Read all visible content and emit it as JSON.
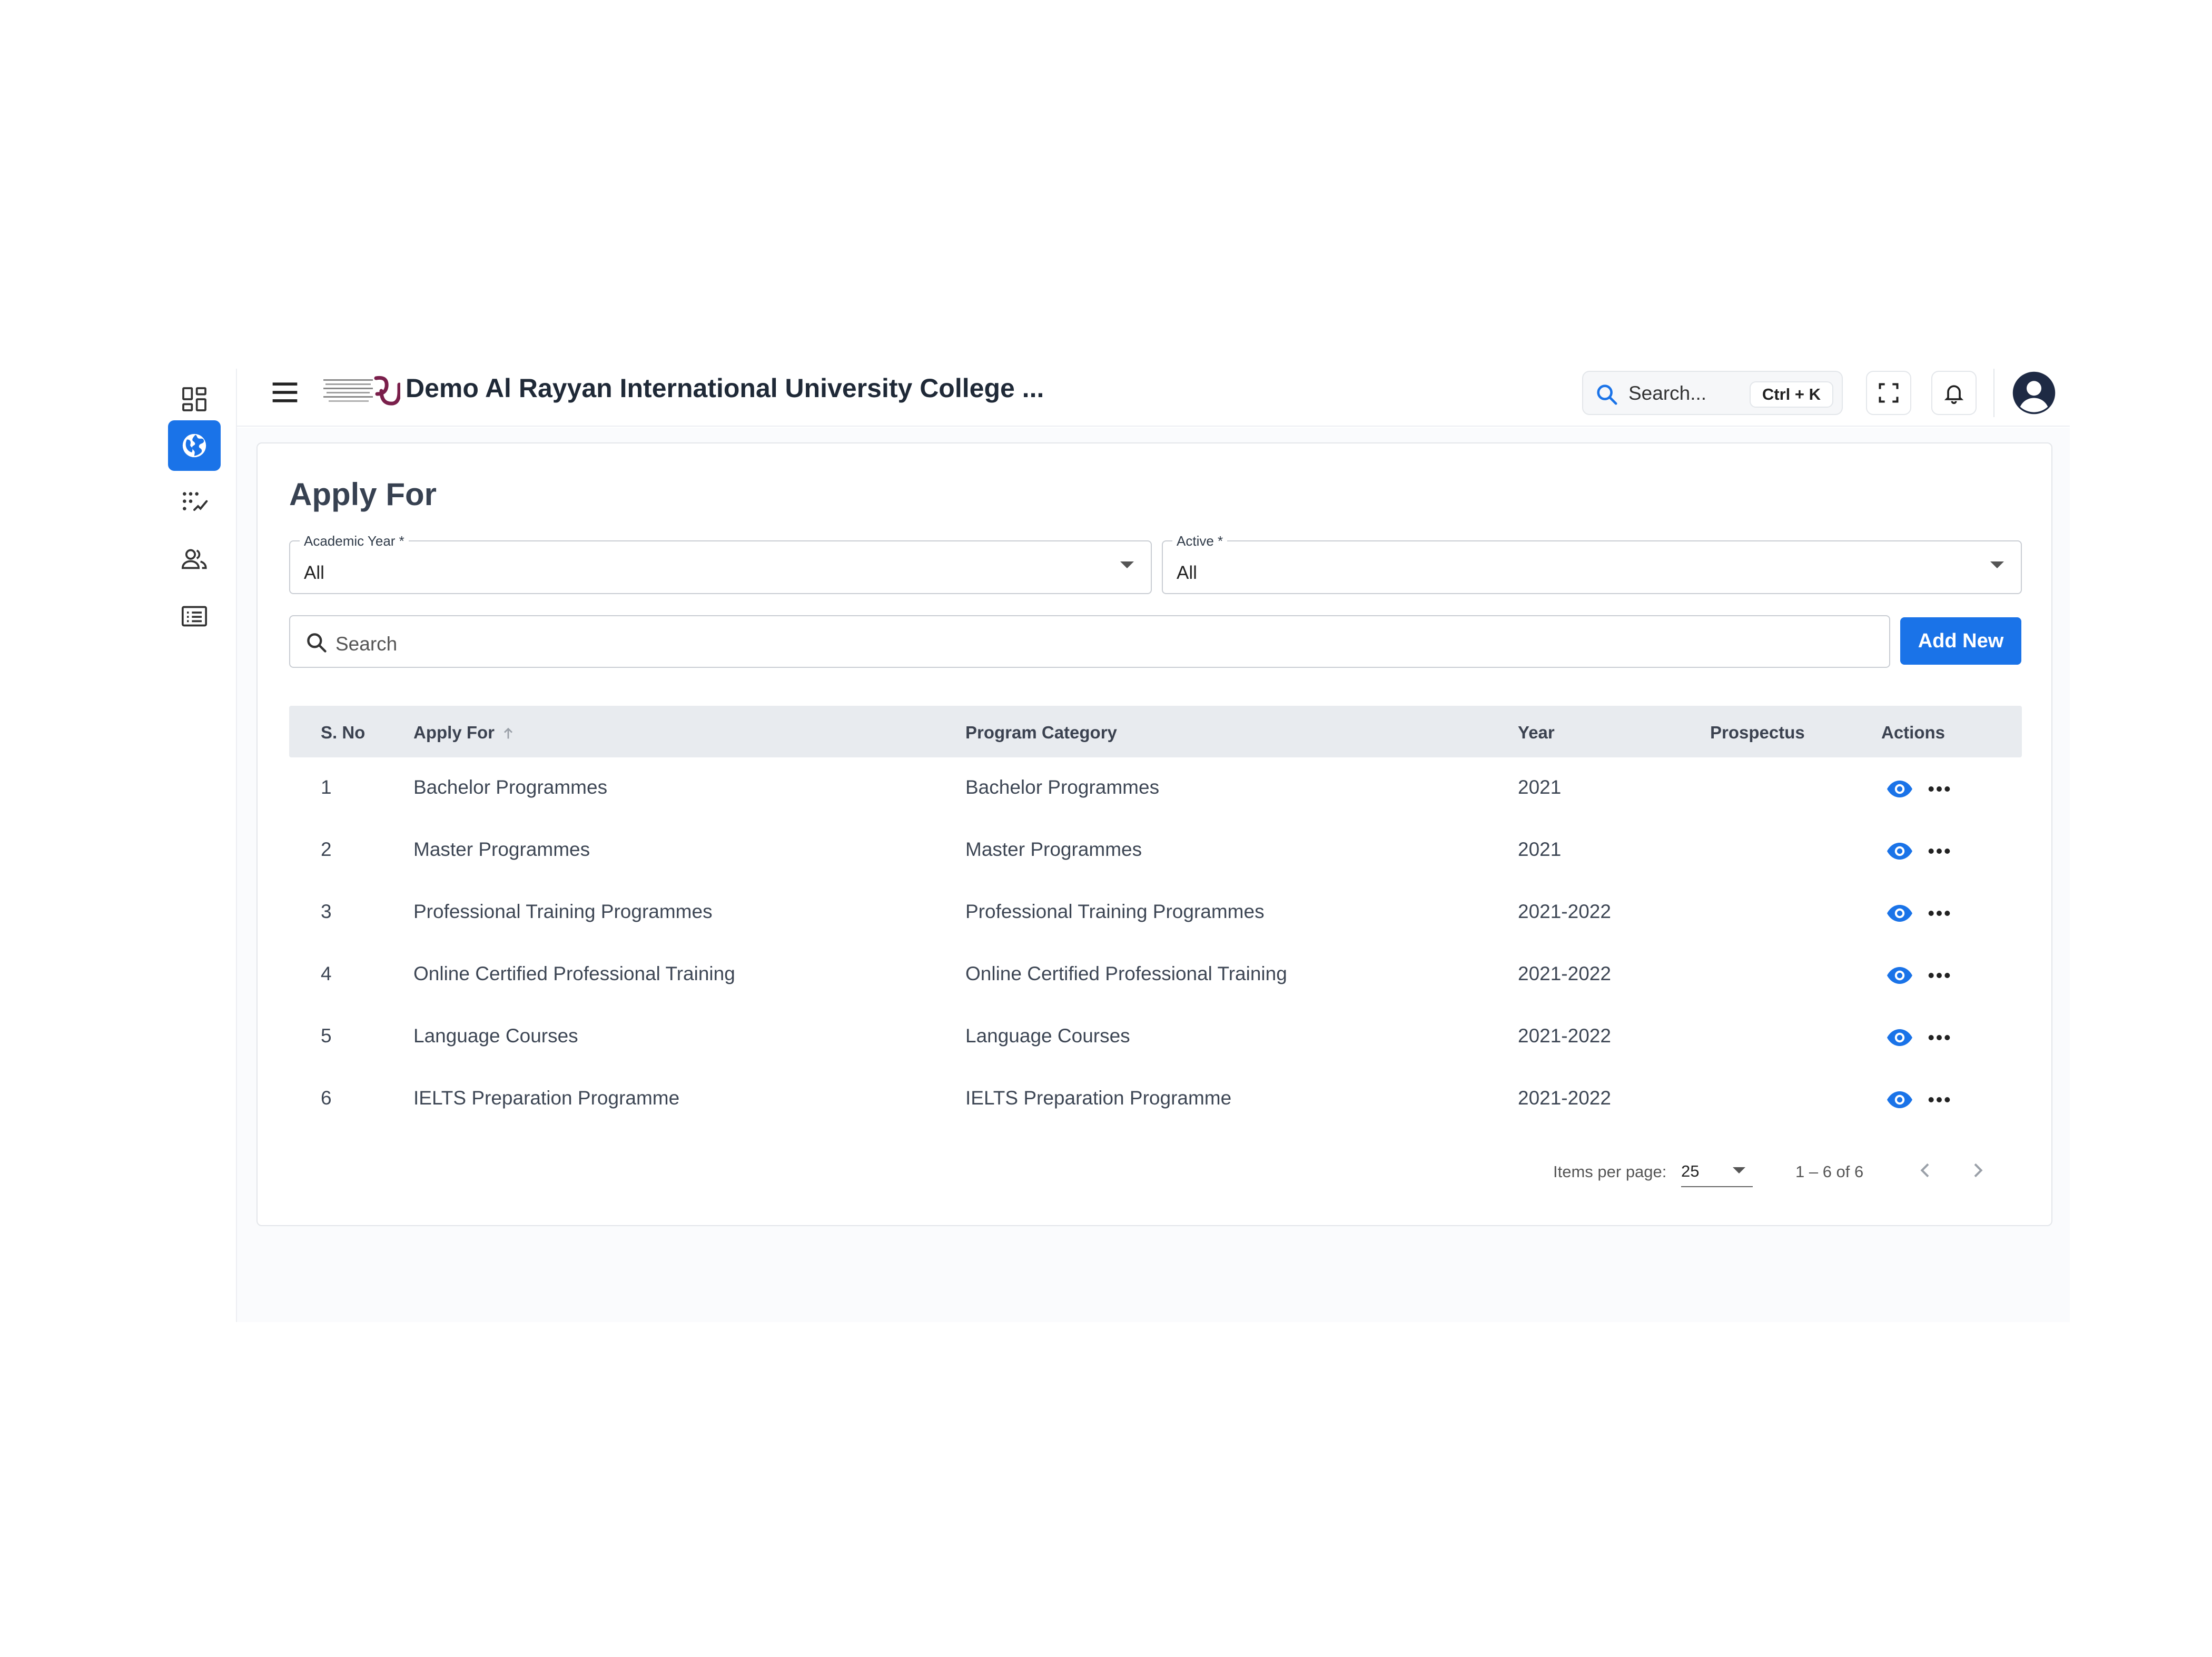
{
  "header": {
    "title": "Demo Al Rayyan International University College ...",
    "search_placeholder": "Search...",
    "search_shortcut": "Ctrl + K"
  },
  "sidebar": {
    "items": [
      {
        "icon": "dashboard-grid-icon",
        "active": false
      },
      {
        "icon": "globe-icon",
        "active": true
      },
      {
        "icon": "checklist-icon",
        "active": false
      },
      {
        "icon": "users-icon",
        "active": false
      },
      {
        "icon": "id-card-icon",
        "active": false
      }
    ]
  },
  "page": {
    "title": "Apply For",
    "filters": {
      "academic_year": {
        "label": "Academic Year *",
        "value": "All"
      },
      "active": {
        "label": "Active *",
        "value": "All"
      }
    },
    "search_placeholder": "Search",
    "add_button": "Add New"
  },
  "table": {
    "columns": [
      "S. No",
      "Apply For",
      "Program Category",
      "Year",
      "Prospectus",
      "Actions"
    ],
    "rows": [
      {
        "sno": "1",
        "apply_for": "Bachelor Programmes",
        "category": "Bachelor Programmes",
        "year": "2021",
        "prospectus": ""
      },
      {
        "sno": "2",
        "apply_for": "Master Programmes",
        "category": "Master Programmes",
        "year": "2021",
        "prospectus": ""
      },
      {
        "sno": "3",
        "apply_for": "Professional Training Programmes",
        "category": "Professional Training Programmes",
        "year": "2021-2022",
        "prospectus": ""
      },
      {
        "sno": "4",
        "apply_for": "Online Certified Professional Training",
        "category": "Online Certified Professional Training",
        "year": "2021-2022",
        "prospectus": ""
      },
      {
        "sno": "5",
        "apply_for": "Language Courses",
        "category": "Language Courses",
        "year": "2021-2022",
        "prospectus": ""
      },
      {
        "sno": "6",
        "apply_for": "IELTS Preparation Programme",
        "category": "IELTS Preparation Programme",
        "year": "2021-2022",
        "prospectus": ""
      }
    ]
  },
  "pagination": {
    "items_per_page_label": "Items per page:",
    "items_per_page": "25",
    "range": "1 – 6 of 6"
  },
  "colors": {
    "accent": "#1a73e8",
    "header_row": "#e8ebef",
    "logo_brand": "#7a1f4b"
  }
}
